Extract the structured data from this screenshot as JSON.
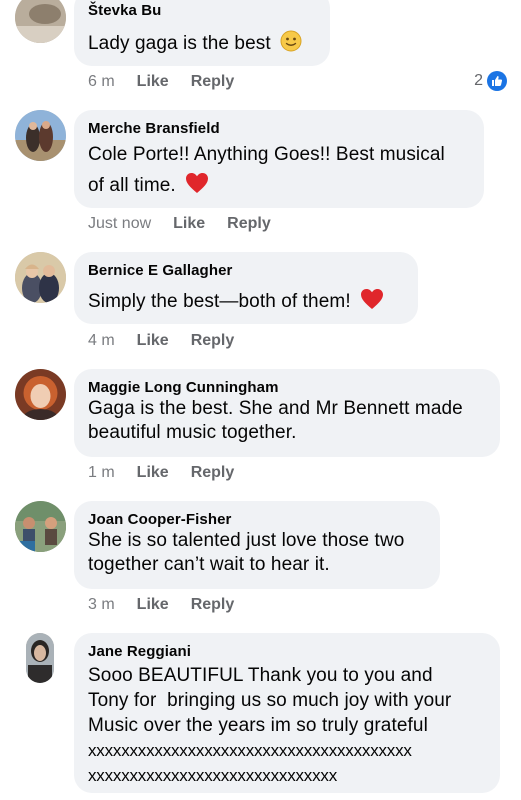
{
  "colors": {
    "bubble": "#f0f2f5",
    "meta": "#65676b",
    "like_blue": "#1b74e4",
    "heart": "#e0262b"
  },
  "comments": [
    {
      "author": "Števka Bu",
      "text": "Lady gaga is the best",
      "emoji": "slightly-smiling-face-emoji",
      "time": "6 m",
      "like": "Like",
      "reply": "Reply",
      "reactions": "2"
    },
    {
      "author": "Merche Bransfield",
      "text_line1": "Cole Porte!! Anything Goes!! Best musical",
      "text_line2": "of all time.",
      "emoji": "red-heart-emoji",
      "time": "Just now",
      "like": "Like",
      "reply": "Reply"
    },
    {
      "author": "Bernice E Gallagher",
      "text": "Simply the best—both of them!",
      "emoji": "red-heart-emoji",
      "time": "4 m",
      "like": "Like",
      "reply": "Reply"
    },
    {
      "author": "Maggie Long Cunningham",
      "text_line1": "Gaga is the best. She and Mr Bennett made",
      "text_line2": "beautiful music together.",
      "time": "1 m",
      "like": "Like",
      "reply": "Reply"
    },
    {
      "author": "Joan Cooper-Fisher",
      "text_line1": "She is so talented just love those two",
      "text_line2": "together can’t wait to hear it.",
      "time": "3 m",
      "like": "Like",
      "reply": "Reply"
    },
    {
      "author": "Jane Reggiani",
      "text_lines": [
        "Sooo BEAUTIFUL Thank you to you and",
        "Tony for  bringing us so much joy with your",
        "Music over the years im so truly grateful",
        "xxxxxxxxxxxxxxxxxxxxxxxxxxxxxxxxxxxxxxx",
        "xxxxxxxxxxxxxxxxxxxxxxxxxxxxxx"
      ]
    }
  ]
}
